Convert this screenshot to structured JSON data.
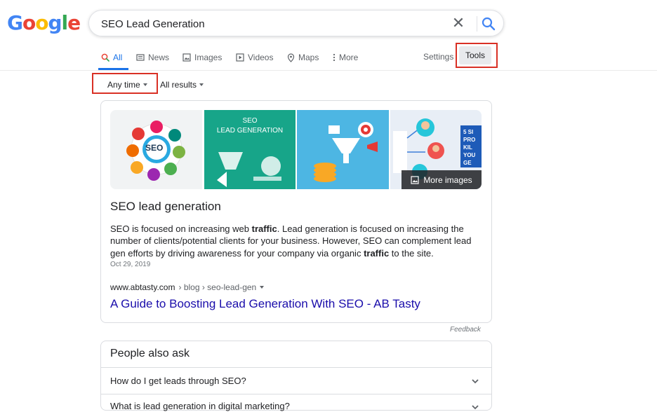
{
  "logo": {
    "text": "Google",
    "letters": [
      {
        "ch": "G",
        "color": "#4285f4"
      },
      {
        "ch": "o",
        "color": "#ea4335"
      },
      {
        "ch": "o",
        "color": "#fbbc05"
      },
      {
        "ch": "g",
        "color": "#4285f4"
      },
      {
        "ch": "l",
        "color": "#34a853"
      },
      {
        "ch": "e",
        "color": "#ea4335"
      }
    ]
  },
  "search": {
    "query": "SEO Lead Generation"
  },
  "tabs": [
    {
      "label": "All",
      "icon": "search-icon",
      "active": true
    },
    {
      "label": "News",
      "icon": "news-icon"
    },
    {
      "label": "Images",
      "icon": "image-icon"
    },
    {
      "label": "Videos",
      "icon": "video-icon"
    },
    {
      "label": "Maps",
      "icon": "map-pin-icon"
    },
    {
      "label": "More",
      "icon": "more-vert-icon"
    }
  ],
  "settings_label": "Settings",
  "tools_label": "Tools",
  "filters": {
    "time": "Any time",
    "results": "All results"
  },
  "snippet": {
    "image_text_2": "SEO\nLEAD GENERATION",
    "image_text_1": "SEO",
    "image_text_1b": "LEAD GENERATION",
    "image_text_4": "5 SI\nPRO\nKIL\nYOU\nGE",
    "more_images": "More images",
    "title": "SEO lead generation",
    "text_parts": [
      "SEO is focused on increasing web ",
      "traffic",
      ". Lead generation is focused on increasing the number of clients/potential clients for your business. However, SEO can complement lead gen efforts by driving awareness for your company via organic ",
      "traffic",
      " to the site."
    ],
    "date": "Oct 29, 2019",
    "cite_domain": "www.abtasty.com",
    "cite_path": " › blog › seo-lead-gen",
    "link": "A Guide to Boosting Lead Generation With SEO - AB Tasty"
  },
  "feedback": "Feedback",
  "paa": {
    "title": "People also ask",
    "questions": [
      "How do I get leads through SEO?",
      "What is lead generation in digital marketing?"
    ]
  },
  "colors": {
    "accent": "#1a73e8",
    "link": "#1a0dab",
    "highlight": "#d93025"
  }
}
